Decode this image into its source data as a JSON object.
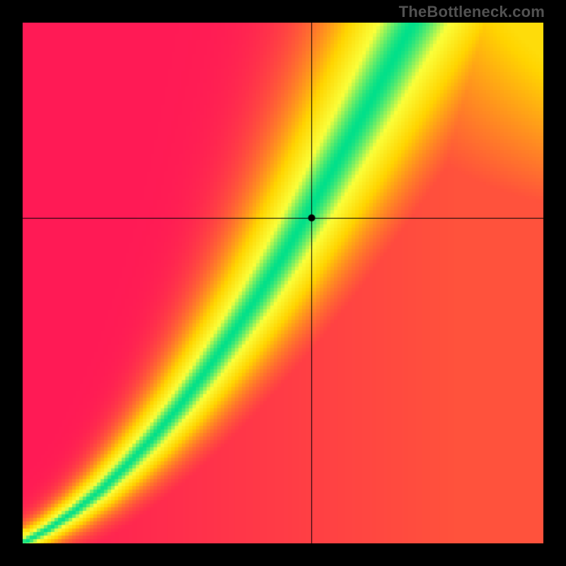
{
  "watermark": "TheBottleneck.com",
  "chart_data": {
    "type": "heatmap",
    "title": "",
    "xlabel": "",
    "ylabel": "",
    "xlim": [
      0,
      1
    ],
    "ylim": [
      0,
      1
    ],
    "crosshair": {
      "x": 0.555,
      "y": 0.625
    },
    "marker": {
      "x": 0.555,
      "y": 0.625
    },
    "colorscale": [
      {
        "value": 0.0,
        "color": "#ff1a55"
      },
      {
        "value": 0.5,
        "color": "#ffd400"
      },
      {
        "value": 0.78,
        "color": "#faff3a"
      },
      {
        "value": 1.0,
        "color": "#00e08a"
      }
    ],
    "optimal_curve": [
      {
        "x": 0.0,
        "y": 0.0
      },
      {
        "x": 0.05,
        "y": 0.028
      },
      {
        "x": 0.1,
        "y": 0.062
      },
      {
        "x": 0.15,
        "y": 0.102
      },
      {
        "x": 0.2,
        "y": 0.15
      },
      {
        "x": 0.25,
        "y": 0.203
      },
      {
        "x": 0.3,
        "y": 0.262
      },
      {
        "x": 0.35,
        "y": 0.328
      },
      {
        "x": 0.4,
        "y": 0.398
      },
      {
        "x": 0.45,
        "y": 0.472
      },
      {
        "x": 0.5,
        "y": 0.552
      },
      {
        "x": 0.55,
        "y": 0.638
      },
      {
        "x": 0.6,
        "y": 0.726
      },
      {
        "x": 0.65,
        "y": 0.816
      },
      {
        "x": 0.7,
        "y": 0.908
      },
      {
        "x": 0.75,
        "y": 1.0
      }
    ],
    "band_width_norm": 0.085,
    "corner_scores": {
      "top_left": 0.0,
      "top_right": 0.55,
      "bottom_left": 0.3,
      "bottom_right": 0.0
    }
  }
}
